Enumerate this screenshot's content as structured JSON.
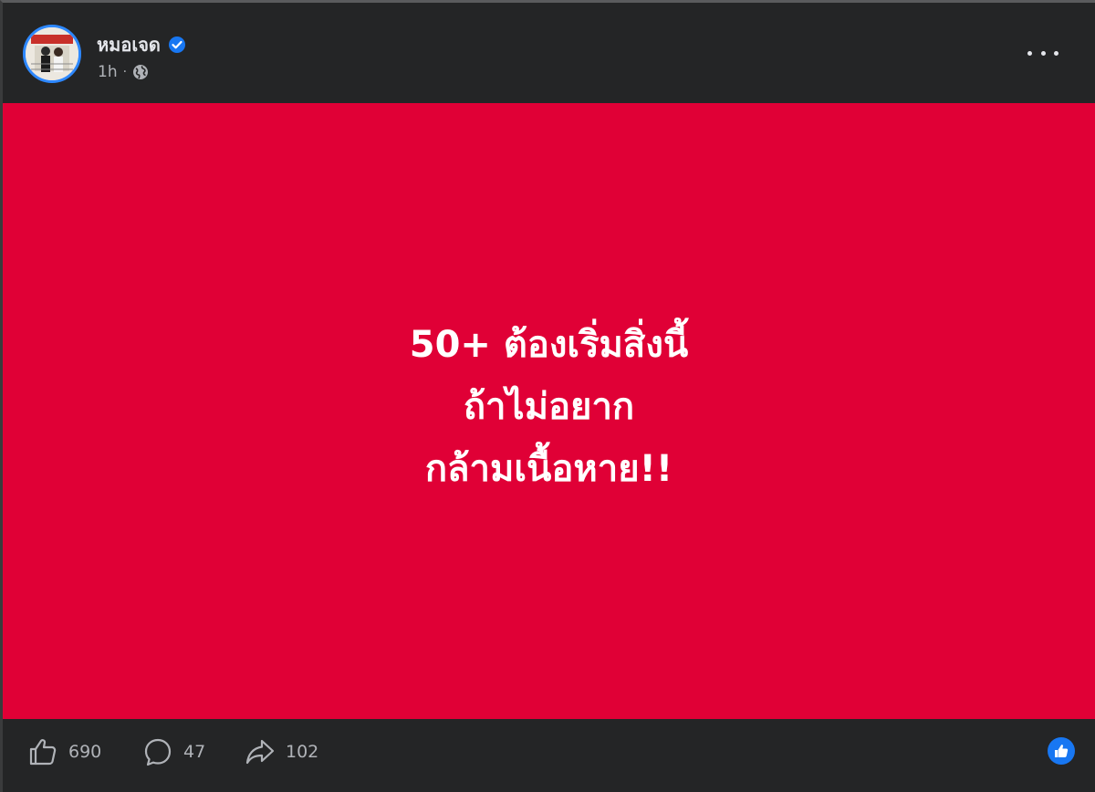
{
  "post": {
    "author": "หมอเจด",
    "time": "1h",
    "separator": "·",
    "image_text": {
      "line1": "50+ ต้องเริ่มสิ่งนี้",
      "line2": "ถ้าไม่อยาก",
      "line3": "กล้ามเนื้อหาย!!"
    },
    "background_color": "#e00036"
  },
  "stats": {
    "likes": "690",
    "comments": "47",
    "shares": "102"
  },
  "icons": {
    "verified": "verified-badge-icon",
    "privacy": "globe-icon",
    "more": "more-options-icon",
    "like": "thumbs-up-icon",
    "comment": "comment-bubble-icon",
    "share": "share-arrow-icon",
    "reaction": "like-reaction-icon"
  },
  "colors": {
    "accent": "#1877f2",
    "header_bg": "#242526",
    "muted_text": "#b0b3b8"
  }
}
